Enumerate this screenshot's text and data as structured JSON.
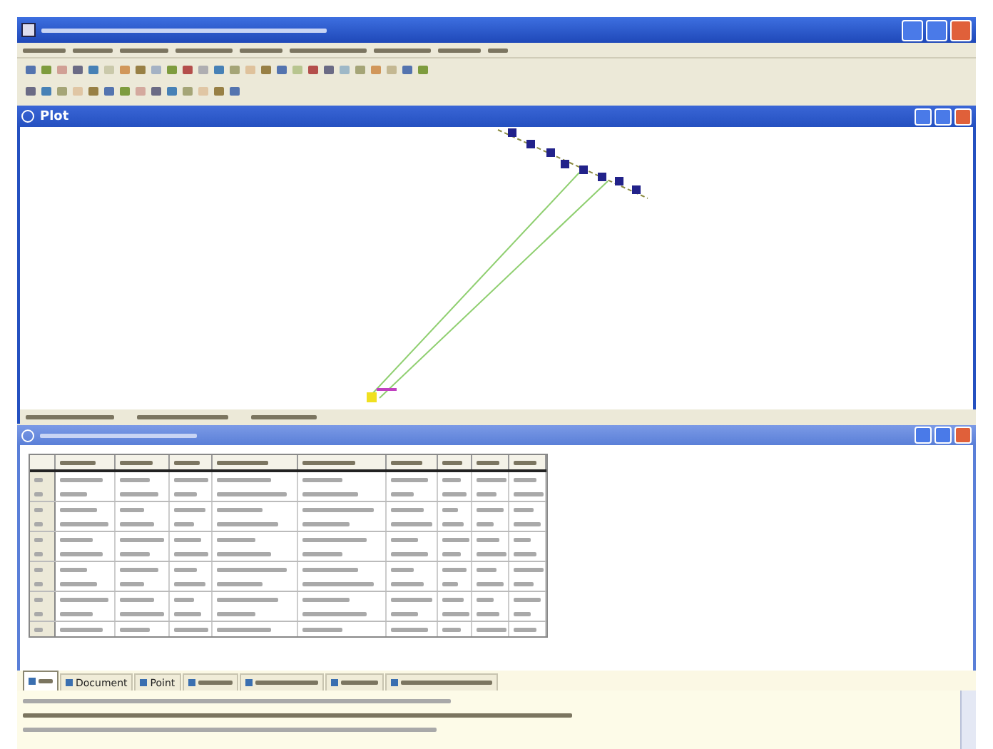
{
  "plot_panel": {
    "title": "Plot"
  },
  "bottom_tabs": [
    {
      "selected": true
    },
    {
      "label": "Document",
      "selected": false
    },
    {
      "label": "Point",
      "selected": false
    },
    {
      "selected": false
    },
    {
      "selected": false
    },
    {
      "selected": false
    },
    {
      "selected": false
    }
  ]
}
